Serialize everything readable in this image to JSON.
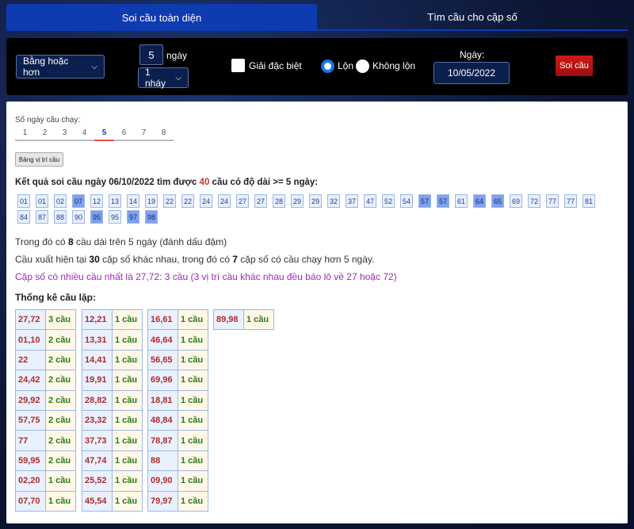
{
  "tabs": [
    {
      "label": "Soi cầu toàn diện",
      "active": true
    },
    {
      "label": "Tìm cầu cho cặp số",
      "active": false
    }
  ],
  "controls": {
    "mode_select": "Bằng hoặc hơn",
    "days_value": "5",
    "days_label": "ngày",
    "step_select": "1 nháy",
    "special_label": "Giải đặc biệt",
    "radio_lon": "Lộn",
    "radio_khong_lon": "Không lộn",
    "date_label": "Ngày:",
    "date_value": "10/05/2022",
    "submit_label": "Soi cầu"
  },
  "panel": {
    "days_run_label": "Số ngày cầu chạy:",
    "day_tabs": [
      "1",
      "2",
      "3",
      "4",
      "5",
      "6",
      "7",
      "8"
    ],
    "active_day": "5",
    "position_button": "Bảng vị trí cầu",
    "result_prefix": "Kết quả soi cầu ngày 06/10/2022 tìm được",
    "result_count": "40",
    "result_suffix": "cầu có độ dài >= 5 ngày:",
    "numbers": [
      {
        "v": "01",
        "long": false
      },
      {
        "v": "01",
        "long": false
      },
      {
        "v": "02",
        "long": false
      },
      {
        "v": "07",
        "long": true
      },
      {
        "v": "12",
        "long": false
      },
      {
        "v": "13",
        "long": false
      },
      {
        "v": "14",
        "long": false
      },
      {
        "v": "19",
        "long": false
      },
      {
        "v": "22",
        "long": false
      },
      {
        "v": "22",
        "long": false
      },
      {
        "v": "24",
        "long": false
      },
      {
        "v": "24",
        "long": false
      },
      {
        "v": "27",
        "long": false
      },
      {
        "v": "27",
        "long": false
      },
      {
        "v": "28",
        "long": false
      },
      {
        "v": "29",
        "long": false
      },
      {
        "v": "29",
        "long": false
      },
      {
        "v": "32",
        "long": false
      },
      {
        "v": "37",
        "long": false
      },
      {
        "v": "47",
        "long": false
      },
      {
        "v": "52",
        "long": false
      },
      {
        "v": "54",
        "long": false
      },
      {
        "v": "57",
        "long": true
      },
      {
        "v": "57",
        "long": true
      },
      {
        "v": "61",
        "long": false
      },
      {
        "v": "64",
        "long": true
      },
      {
        "v": "65",
        "long": true
      },
      {
        "v": "69",
        "long": false
      },
      {
        "v": "72",
        "long": false
      },
      {
        "v": "77",
        "long": false
      },
      {
        "v": "77",
        "long": false
      },
      {
        "v": "81",
        "long": false
      },
      {
        "v": "84",
        "long": false
      },
      {
        "v": "87",
        "long": false
      },
      {
        "v": "88",
        "long": false
      },
      {
        "v": "90",
        "long": false
      },
      {
        "v": "95",
        "long": true
      },
      {
        "v": "95",
        "long": false
      },
      {
        "v": "97",
        "long": true
      },
      {
        "v": "98",
        "long": true
      }
    ],
    "line1_a": "Trong đó có",
    "line1_n": "8",
    "line1_b": "cầu dài trên 5 ngày (đánh dấu đậm)",
    "line2_a": "Cầu xuất hiện tại",
    "line2_n1": "30",
    "line2_b": "cặp số khác nhau, trong đó có",
    "line2_n2": "7",
    "line2_c": "cặp số có cầu chạy hơn 5 ngày.",
    "line3": "Cặp số có nhiều cầu nhất là 27,72: 3 cầu (3 vị trí cầu khác nhau đều báo lô về 27 hoặc 72)",
    "stats_title": "Thống kê cầu lặp:",
    "stats": [
      [
        [
          "27,72",
          "3 cầu"
        ],
        [
          "01,10",
          "2 cầu"
        ],
        [
          "22",
          "2 cầu"
        ],
        [
          "24,42",
          "2 cầu"
        ],
        [
          "29,92",
          "2 cầu"
        ],
        [
          "57,75",
          "2 cầu"
        ],
        [
          "77",
          "2 cầu"
        ],
        [
          "59,95",
          "2 cầu"
        ],
        [
          "02,20",
          "1 cầu"
        ],
        [
          "07,70",
          "1 cầu"
        ]
      ],
      [
        [
          "12,21",
          "1 cầu"
        ],
        [
          "13,31",
          "1 cầu"
        ],
        [
          "14,41",
          "1 cầu"
        ],
        [
          "19,91",
          "1 cầu"
        ],
        [
          "28,82",
          "1 cầu"
        ],
        [
          "23,32",
          "1 cầu"
        ],
        [
          "37,73",
          "1 cầu"
        ],
        [
          "47,74",
          "1 cầu"
        ],
        [
          "25,52",
          "1 cầu"
        ],
        [
          "45,54",
          "1 cầu"
        ]
      ],
      [
        [
          "16,61",
          "1 cầu"
        ],
        [
          "46,64",
          "1 cầu"
        ],
        [
          "56,65",
          "1 cầu"
        ],
        [
          "69,96",
          "1 cầu"
        ],
        [
          "18,81",
          "1 cầu"
        ],
        [
          "48,84",
          "1 cầu"
        ],
        [
          "78,87",
          "1 cầu"
        ],
        [
          "88",
          "1 cầu"
        ],
        [
          "09,90",
          "1 cầu"
        ],
        [
          "79,97",
          "1 cầu"
        ]
      ],
      [
        [
          "89,98",
          "1 cầu"
        ]
      ]
    ]
  }
}
